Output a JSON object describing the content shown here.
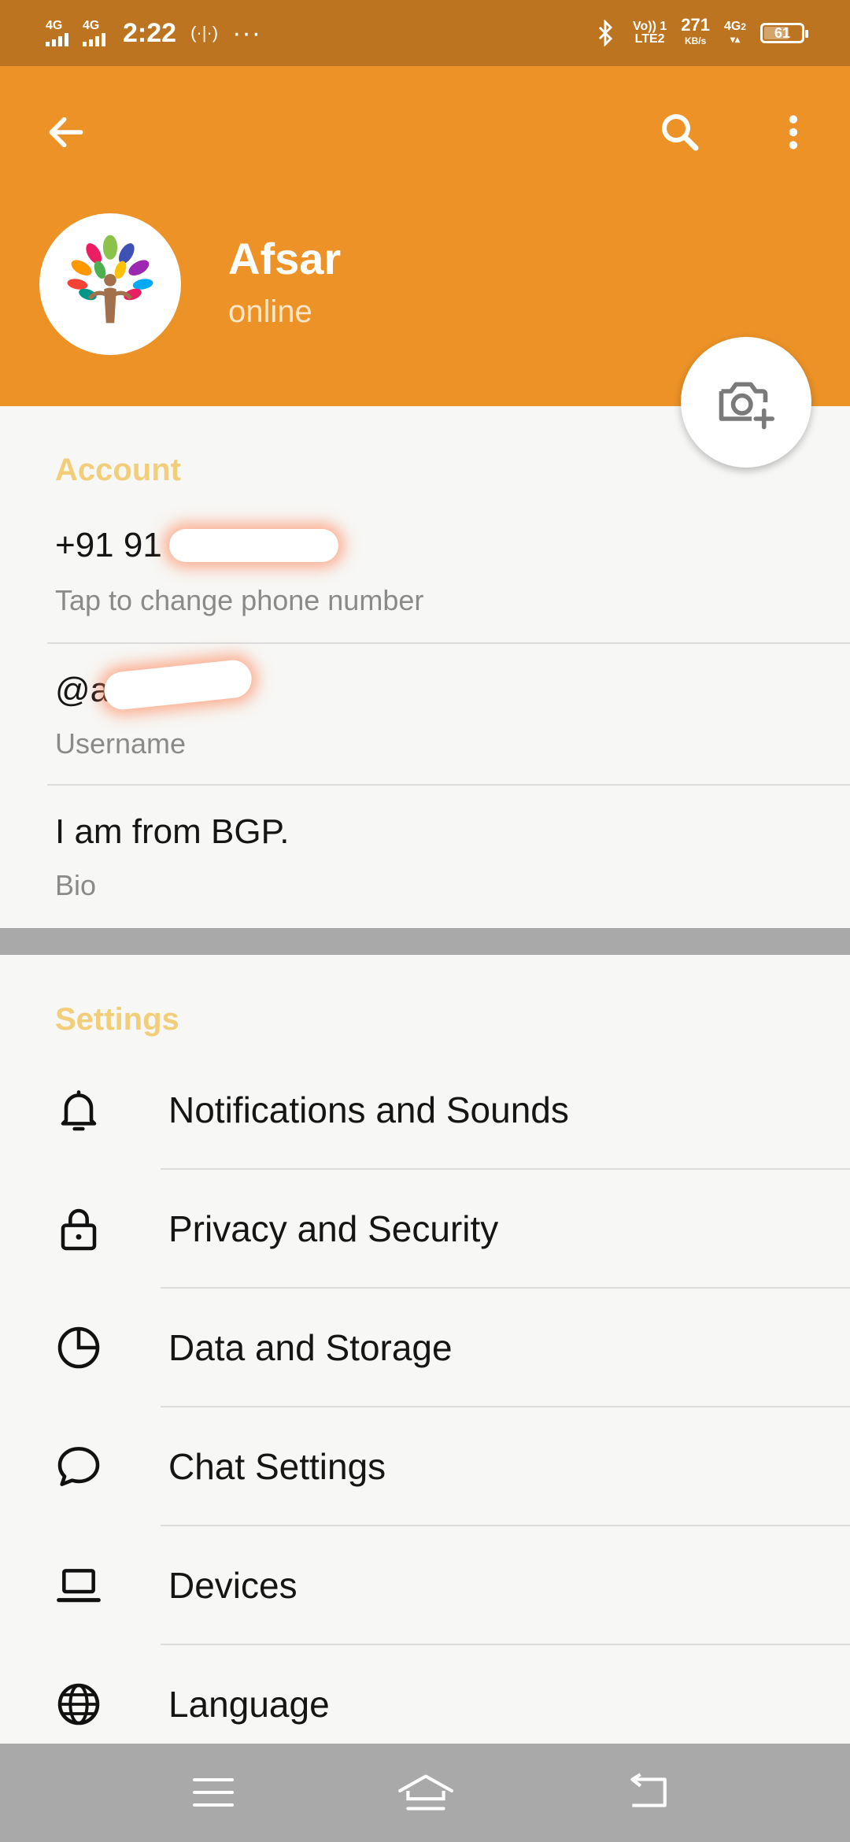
{
  "status_bar": {
    "network1": "4G",
    "network2": "4G",
    "time": "2:22",
    "hotspot_icon": "hotspot-icon",
    "more": "···",
    "bluetooth_icon": "bluetooth-icon",
    "volte_top": "Vo)) 1",
    "volte_bottom": "LTE2",
    "speed_value": "271",
    "speed_unit": "KB/s",
    "network3": "4G",
    "network3_sub": "2",
    "battery_level": "61"
  },
  "header": {
    "back_icon": "back-arrow-icon",
    "search_icon": "search-icon",
    "menu_icon": "more-vertical-icon",
    "name": "Afsar",
    "status": "online",
    "camera_icon": "camera-add-icon"
  },
  "account": {
    "title": "Account",
    "phone_visible": "+91 91",
    "phone_hint": "Tap to change phone number",
    "username_visible": "@a",
    "username_hint": "Username",
    "bio": "I am from BGP.",
    "bio_hint": "Bio"
  },
  "settings": {
    "title": "Settings",
    "items": [
      {
        "label": "Notifications and Sounds",
        "icon": "bell-icon"
      },
      {
        "label": "Privacy and Security",
        "icon": "lock-icon"
      },
      {
        "label": "Data and Storage",
        "icon": "pie-chart-icon"
      },
      {
        "label": "Chat Settings",
        "icon": "chat-bubble-icon"
      },
      {
        "label": "Devices",
        "icon": "laptop-icon"
      },
      {
        "label": "Language",
        "icon": "globe-icon"
      }
    ]
  },
  "nav_bar": {
    "menu_icon": "recent-apps-icon",
    "home_icon": "home-icon",
    "back_icon": "back-nav-icon"
  },
  "colors": {
    "header": "#ec9227",
    "status_bar": "#bd7420",
    "section_title": "#f2ce7a",
    "background": "#f7f7f5",
    "nav_bar": "#a9a9a9"
  }
}
